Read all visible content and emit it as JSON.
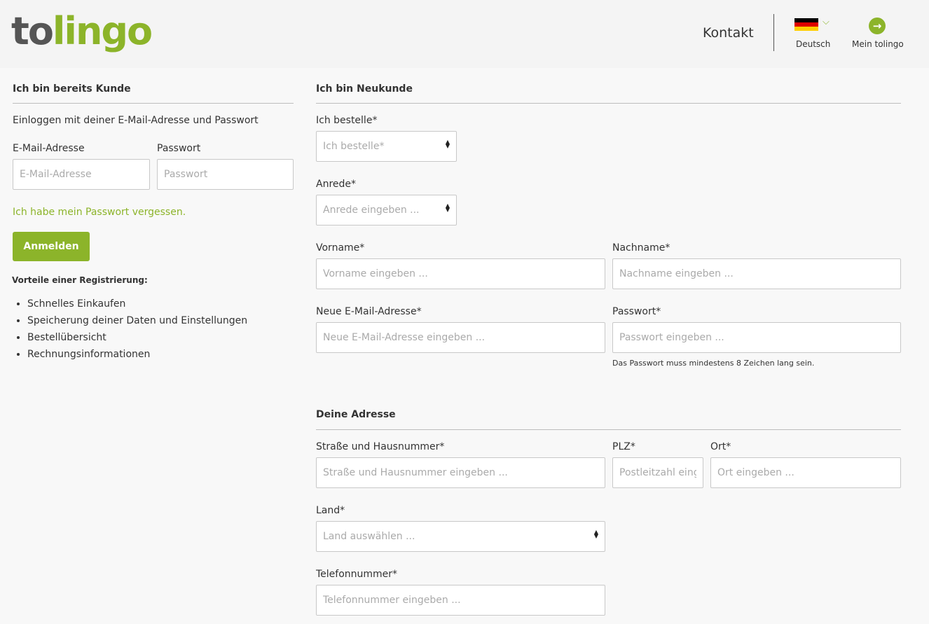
{
  "header": {
    "logo_part1": "to",
    "logo_part2": "lingo",
    "contact": "Kontakt",
    "language": "Deutsch",
    "my_account": "Mein tolingo"
  },
  "login": {
    "heading": "Ich bin bereits Kunde",
    "intro": "Einloggen mit deiner E-Mail-Adresse und Passwort",
    "email_label": "E-Mail-Adresse",
    "email_placeholder": "E-Mail-Adresse",
    "password_label": "Passwort",
    "password_placeholder": "Passwort",
    "forgot": "Ich habe mein Passwort vergessen.",
    "submit": "Anmelden",
    "benefits_heading": "Vorteile einer Registrierung:",
    "benefits": [
      "Schnelles Einkaufen",
      "Speicherung deiner Daten und Einstellungen",
      "Bestellübersicht",
      "Rechnungsinformationen"
    ]
  },
  "register": {
    "heading": "Ich bin Neukunde",
    "order_label": "Ich bestelle*",
    "order_placeholder": "Ich bestelle*",
    "salutation_label": "Anrede*",
    "salutation_placeholder": "Anrede eingeben ...",
    "firstname_label": "Vorname*",
    "firstname_placeholder": "Vorname eingeben ...",
    "lastname_label": "Nachname*",
    "lastname_placeholder": "Nachname eingeben ...",
    "email_label": "Neue E-Mail-Adresse*",
    "email_placeholder": "Neue E-Mail-Adresse eingeben ...",
    "password_label": "Passwort*",
    "password_placeholder": "Passwort eingeben ...",
    "password_hint": "Das Passwort muss mindestens 8 Zeichen lang sein."
  },
  "address": {
    "heading": "Deine Adresse",
    "street_label": "Straße und Hausnummer*",
    "street_placeholder": "Straße und Hausnummer eingeben ...",
    "zip_label": "PLZ*",
    "zip_placeholder": "Postleitzahl eingeben",
    "city_label": "Ort*",
    "city_placeholder": "Ort eingeben ...",
    "country_label": "Land*",
    "country_placeholder": "Land auswählen ...",
    "phone_label": "Telefonnummer*",
    "phone_placeholder": "Telefonnummer eingeben ..."
  },
  "colors": {
    "accent": "#8cb42a",
    "text": "#333333"
  }
}
